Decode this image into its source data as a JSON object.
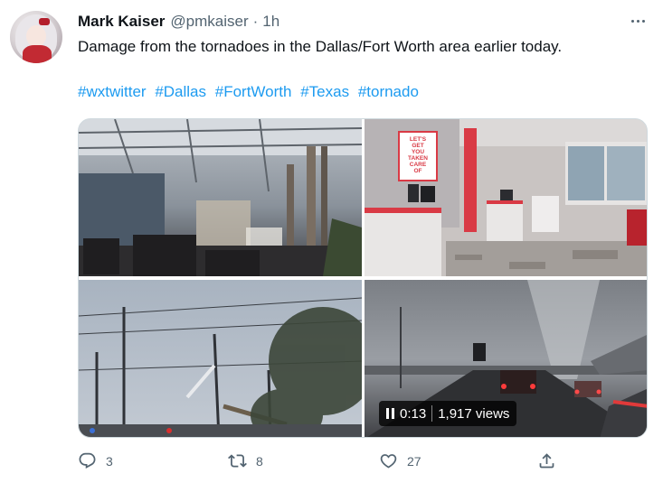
{
  "tweet": {
    "author_name": "Mark Kaiser",
    "handle": "@pmkaiser",
    "separator": "·",
    "time": "1h",
    "text": "Damage from the tornadoes in the Dallas/Fort Worth area earlier today.",
    "hashtags": [
      "#wxtwitter",
      "#Dallas",
      "#FortWorth",
      "#Texas",
      "#tornado"
    ]
  },
  "media": {
    "store_sign_text": [
      "LET'S",
      "GET",
      "YOU",
      "TAKEN",
      "CARE",
      "OF"
    ],
    "video": {
      "duration": "0:13",
      "views": "1,917 views"
    }
  },
  "actions": {
    "reply_count": "3",
    "retweet_count": "8",
    "like_count": "27"
  },
  "colors": {
    "accent": "#1d9bf0",
    "muted": "#536471",
    "text": "#0f1419"
  }
}
